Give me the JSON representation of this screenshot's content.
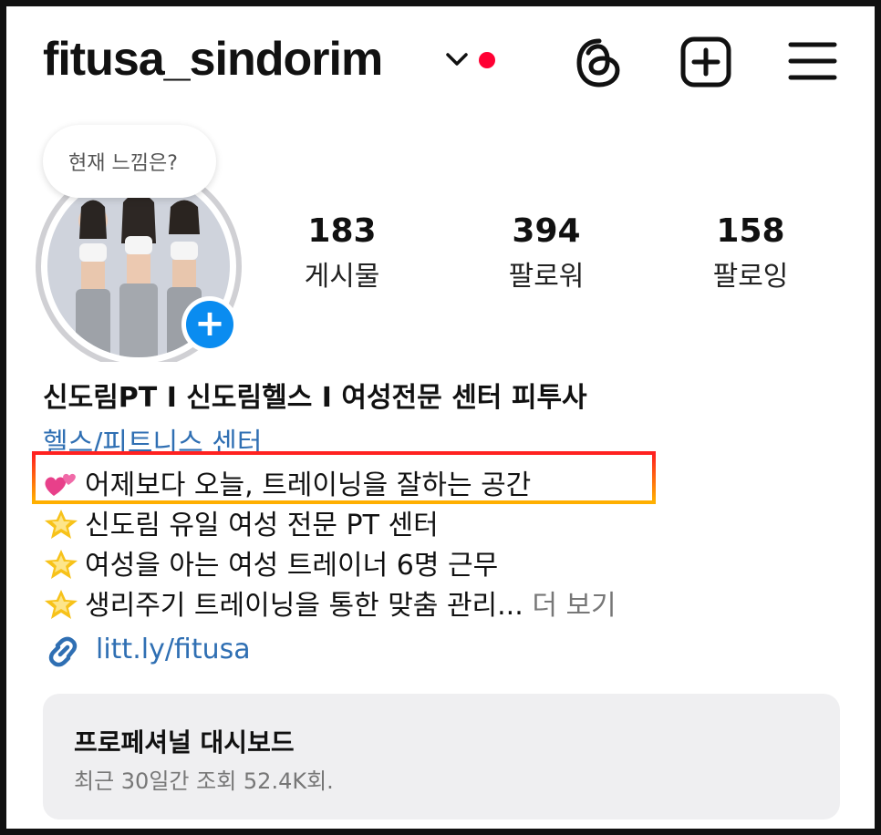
{
  "header": {
    "username": "fitusa_sindorim",
    "icons": [
      "chevron-down-icon",
      "notification-dot",
      "threads-icon",
      "add-post-icon",
      "menu-icon"
    ],
    "dot_color": "#ff0033"
  },
  "profile": {
    "note": "현재 느낌은?",
    "stats": [
      {
        "value": "183",
        "label": "게시물"
      },
      {
        "value": "394",
        "label": "팔로워"
      },
      {
        "value": "158",
        "label": "팔로잉"
      }
    ]
  },
  "bio": {
    "name": "신도림PT I 신도림헬스 I 여성전문 센터 피투사",
    "category": "헬스/피트니스 센터",
    "line1": "어제보다 오늘, 트레이닝을 잘하는 공간",
    "line2": "신도림 유일 여성 전문 PT 센터",
    "line3": "여성을 아는 여성 트레이너 6명 근무",
    "line4": "생리주기 트레이닝을 통한 맞춤 관리...",
    "more": "더 보기",
    "link": "litt.ly/fitusa",
    "link_color": "#2f6fb3"
  },
  "dashboard": {
    "title": "프로페셔널 대시보드",
    "subtitle": "최근 30일간 조회 52.4K회."
  }
}
